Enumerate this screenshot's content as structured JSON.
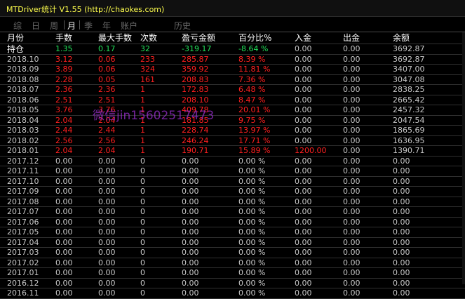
{
  "window": {
    "title": "MTDriver统计 V1.55  (http://chaokes.com)"
  },
  "tabs": [
    {
      "label": "综",
      "active": false
    },
    {
      "label": "日",
      "active": false
    },
    {
      "label": "周",
      "active": false
    },
    {
      "label": "月",
      "active": true
    },
    {
      "label": "季",
      "active": false
    },
    {
      "label": "年",
      "active": false
    },
    {
      "label": "账户",
      "active": false
    },
    {
      "label": "历史",
      "active": false
    }
  ],
  "table": {
    "headers": [
      "月份",
      "手数",
      "最大手数",
      "次数",
      "盈亏金额",
      "百分比%",
      "入金",
      "出金",
      "余额"
    ],
    "rows": [
      {
        "style": "hold",
        "cells": [
          "持仓",
          "1.35",
          "0.17",
          "32",
          "-319.17",
          "-8.64 %",
          "0.00",
          "0.00",
          "3692.87"
        ]
      },
      {
        "style": "red",
        "cells": [
          "2018.10",
          "3.12",
          "0.06",
          "233",
          "285.87",
          "8.39 %",
          "0.00",
          "0.00",
          "3692.87"
        ]
      },
      {
        "style": "red",
        "cells": [
          "2018.09",
          "3.89",
          "0.06",
          "324",
          "359.92",
          "11.81 %",
          "0.00",
          "0.00",
          "3407.00"
        ]
      },
      {
        "style": "red",
        "cells": [
          "2018.08",
          "2.28",
          "0.05",
          "161",
          "208.83",
          "7.36 %",
          "0.00",
          "0.00",
          "3047.08"
        ]
      },
      {
        "style": "red",
        "cells": [
          "2018.07",
          "2.36",
          "2.36",
          "1",
          "172.83",
          "6.48 %",
          "0.00",
          "0.00",
          "2838.25"
        ]
      },
      {
        "style": "red",
        "cells": [
          "2018.06",
          "2.51",
          "2.51",
          "1",
          "208.10",
          "8.47 %",
          "0.00",
          "0.00",
          "2665.42"
        ]
      },
      {
        "style": "red",
        "cells": [
          "2018.05",
          "3.76",
          "3.76",
          "1",
          "409.78",
          "20.01 %",
          "0.00",
          "0.00",
          "2457.32"
        ]
      },
      {
        "style": "red",
        "cells": [
          "2018.04",
          "2.04",
          "2.04",
          "1",
          "181.85",
          "9.75 %",
          "0.00",
          "0.00",
          "2047.54"
        ]
      },
      {
        "style": "red",
        "cells": [
          "2018.03",
          "2.44",
          "2.44",
          "1",
          "228.74",
          "13.97 %",
          "0.00",
          "0.00",
          "1865.69"
        ]
      },
      {
        "style": "red",
        "cells": [
          "2018.02",
          "2.56",
          "2.56",
          "1",
          "246.24",
          "17.71 %",
          "0.00",
          "0.00",
          "1636.95"
        ]
      },
      {
        "style": "red",
        "deposit_highlight": true,
        "cells": [
          "2018.01",
          "2.04",
          "2.04",
          "1",
          "190.71",
          "15.89 %",
          "1200.00",
          "0.00",
          "1390.71"
        ]
      },
      {
        "style": "gray",
        "cells": [
          "2017.12",
          "0.00",
          "0.00",
          "0",
          "0.00",
          "0.00 %",
          "0.00",
          "0.00",
          "0.00"
        ]
      },
      {
        "style": "gray",
        "cells": [
          "2017.11",
          "0.00",
          "0.00",
          "0",
          "0.00",
          "0.00 %",
          "0.00",
          "0.00",
          "0.00"
        ]
      },
      {
        "style": "gray",
        "cells": [
          "2017.10",
          "0.00",
          "0.00",
          "0",
          "0.00",
          "0.00 %",
          "0.00",
          "0.00",
          "0.00"
        ]
      },
      {
        "style": "gray",
        "cells": [
          "2017.09",
          "0.00",
          "0.00",
          "0",
          "0.00",
          "0.00 %",
          "0.00",
          "0.00",
          "0.00"
        ]
      },
      {
        "style": "gray",
        "cells": [
          "2017.08",
          "0.00",
          "0.00",
          "0",
          "0.00",
          "0.00 %",
          "0.00",
          "0.00",
          "0.00"
        ]
      },
      {
        "style": "gray",
        "cells": [
          "2017.07",
          "0.00",
          "0.00",
          "0",
          "0.00",
          "0.00 %",
          "0.00",
          "0.00",
          "0.00"
        ]
      },
      {
        "style": "gray",
        "cells": [
          "2017.06",
          "0.00",
          "0.00",
          "0",
          "0.00",
          "0.00 %",
          "0.00",
          "0.00",
          "0.00"
        ]
      },
      {
        "style": "gray",
        "cells": [
          "2017.05",
          "0.00",
          "0.00",
          "0",
          "0.00",
          "0.00 %",
          "0.00",
          "0.00",
          "0.00"
        ]
      },
      {
        "style": "gray",
        "cells": [
          "2017.04",
          "0.00",
          "0.00",
          "0",
          "0.00",
          "0.00 %",
          "0.00",
          "0.00",
          "0.00"
        ]
      },
      {
        "style": "gray",
        "cells": [
          "2017.03",
          "0.00",
          "0.00",
          "0",
          "0.00",
          "0.00 %",
          "0.00",
          "0.00",
          "0.00"
        ]
      },
      {
        "style": "gray",
        "cells": [
          "2017.02",
          "0.00",
          "0.00",
          "0",
          "0.00",
          "0.00 %",
          "0.00",
          "0.00",
          "0.00"
        ]
      },
      {
        "style": "gray",
        "cells": [
          "2017.01",
          "0.00",
          "0.00",
          "0",
          "0.00",
          "0.00 %",
          "0.00",
          "0.00",
          "0.00"
        ]
      },
      {
        "style": "gray",
        "cells": [
          "2016.12",
          "0.00",
          "0.00",
          "0",
          "0.00",
          "0.00 %",
          "0.00",
          "0.00",
          "0.00"
        ]
      },
      {
        "style": "gray",
        "cells": [
          "2016.11",
          "0.00",
          "0.00",
          "0",
          "0.00",
          "0.00 %",
          "0.00",
          "0.00",
          "0.00"
        ]
      }
    ]
  },
  "watermark": "微信jin15602517473",
  "colors": {
    "title": "#ffff4d",
    "profit_red": "#ff2020",
    "hold_green": "#22e05a",
    "text_gray": "#c8c8c8",
    "watermark": "#9a2fd1"
  }
}
